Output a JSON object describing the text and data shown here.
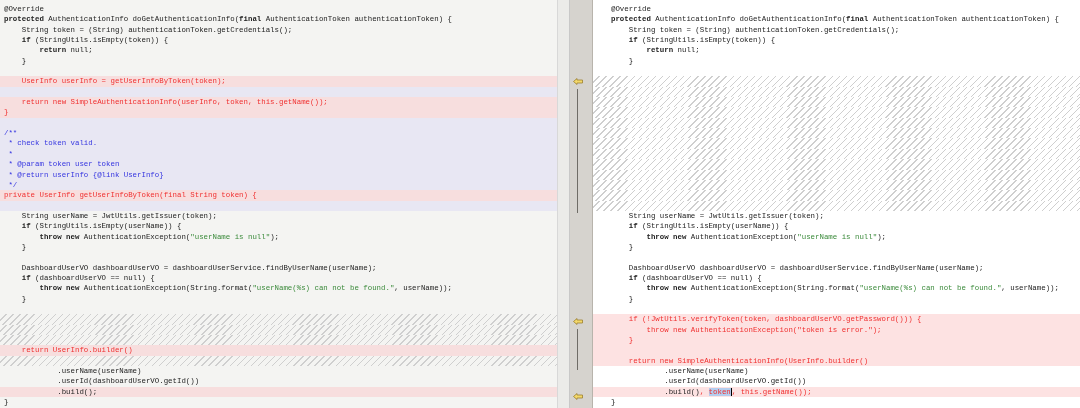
{
  "left_pane": {
    "lines": [
      {
        "kind": "plain",
        "text": "@Override"
      },
      {
        "kind": "plain",
        "parts": [
          {
            "text": "protected",
            "kind": "keyword"
          },
          {
            "text": " AuthenticationInfo doGetAuthenticationInfo("
          },
          {
            "text": "final",
            "kind": "keyword"
          },
          {
            "text": " AuthenticationToken authenticationToken) {"
          }
        ]
      },
      {
        "kind": "plain",
        "text": "    String token = (String) authenticationToken.getCredentials();"
      },
      {
        "kind": "plain",
        "parts": [
          {
            "text": "    if",
            "kind": "keyword"
          },
          {
            "text": " (StringUtils.isEmpty(token)) {"
          }
        ]
      },
      {
        "kind": "plain",
        "parts": [
          {
            "text": "        return",
            "kind": "keyword"
          },
          {
            "text": " null;"
          }
        ]
      },
      {
        "kind": "plain",
        "text": "    }"
      },
      {
        "kind": "plain"
      },
      {
        "kind": "changed",
        "text": "    UserInfo userInfo = getUserInfoByToken(token);"
      },
      {
        "kind": "unmatched"
      },
      {
        "kind": "changed",
        "text": "    return new SimpleAuthenticationInfo(userInfo, token, this.getName());"
      },
      {
        "kind": "changed",
        "text": "}"
      },
      {
        "kind": "unmatched"
      },
      {
        "kind": "unmatched",
        "text": "/**"
      },
      {
        "kind": "unmatched",
        "text": " * check token valid."
      },
      {
        "kind": "unmatched",
        "text": " *"
      },
      {
        "kind": "unmatched",
        "text": " * @param token user token"
      },
      {
        "kind": "unmatched",
        "text": " * @return userInfo {@link UserInfo}"
      },
      {
        "kind": "unmatched",
        "text": " */"
      },
      {
        "kind": "changed",
        "text": "private UserInfo getUserInfoByToken(final String token) {"
      },
      {
        "kind": "unmatched"
      },
      {
        "kind": "plain",
        "text": "    String userName = JwtUtils.getIssuer(token);"
      },
      {
        "kind": "plain",
        "parts": [
          {
            "text": "    if",
            "kind": "keyword"
          },
          {
            "text": " (StringUtils.isEmpty(userName)) {"
          }
        ]
      },
      {
        "kind": "plain",
        "parts": [
          {
            "text": "        throw new",
            "kind": "keyword"
          },
          {
            "text": " AuthenticationException("
          },
          {
            "text": "\"userName is null\"",
            "kind": "string"
          },
          {
            "text": ");"
          }
        ]
      },
      {
        "kind": "plain",
        "text": "    }"
      },
      {
        "kind": "plain"
      },
      {
        "kind": "plain",
        "text": "    DashboardUserVO dashboardUserVO = dashboardUserService.findByUserName(userName);"
      },
      {
        "kind": "plain",
        "parts": [
          {
            "text": "    if",
            "kind": "keyword"
          },
          {
            "text": " (dashboardUserVO == null) {"
          }
        ]
      },
      {
        "kind": "plain",
        "parts": [
          {
            "text": "        throw new",
            "kind": "keyword"
          },
          {
            "text": " AuthenticationException(String.format("
          },
          {
            "text": "\"userName(%s) can not be found.\"",
            "kind": "string"
          },
          {
            "text": ", userName));"
          }
        ]
      },
      {
        "kind": "plain",
        "text": "    }"
      },
      {
        "kind": "plain"
      },
      {
        "kind": "hatched"
      },
      {
        "kind": "hatched"
      },
      {
        "kind": "hatched"
      },
      {
        "kind": "changed",
        "text": "    return UserInfo.builder()"
      },
      {
        "kind": "hatched"
      },
      {
        "kind": "plain",
        "text": "            .userName(userName)"
      },
      {
        "kind": "plain",
        "text": "            .userId(dashboardUserVO.getId())"
      },
      {
        "kind": "changed",
        "parts": [
          {
            "text": "            .build();",
            "kind": "neutral"
          }
        ]
      },
      {
        "kind": "plain",
        "text": "}"
      }
    ]
  },
  "right_pane": {
    "lines": [
      {
        "kind": "plain",
        "text": "@Override"
      },
      {
        "kind": "plain",
        "parts": [
          {
            "text": "protected",
            "kind": "keyword"
          },
          {
            "text": " AuthenticationInfo doGetAuthenticationInfo("
          },
          {
            "text": "final",
            "kind": "keyword"
          },
          {
            "text": " AuthenticationToken authenticationToken) {"
          }
        ]
      },
      {
        "kind": "plain",
        "text": "    String token = (String) authenticationToken.getCredentials();"
      },
      {
        "kind": "plain",
        "parts": [
          {
            "text": "    if",
            "kind": "keyword"
          },
          {
            "text": " (StringUtils.isEmpty(token)) {"
          }
        ]
      },
      {
        "kind": "plain",
        "parts": [
          {
            "text": "        return",
            "kind": "keyword"
          },
          {
            "text": " null;"
          }
        ]
      },
      {
        "kind": "plain",
        "text": "    }"
      },
      {
        "kind": "plain"
      },
      {
        "kind": "hatched",
        "merge": true
      },
      {
        "kind": "hatched"
      },
      {
        "kind": "hatched"
      },
      {
        "kind": "hatched"
      },
      {
        "kind": "hatched"
      },
      {
        "kind": "hatched"
      },
      {
        "kind": "hatched"
      },
      {
        "kind": "hatched"
      },
      {
        "kind": "hatched"
      },
      {
        "kind": "hatched"
      },
      {
        "kind": "hatched"
      },
      {
        "kind": "hatched"
      },
      {
        "kind": "hatched"
      },
      {
        "kind": "plain",
        "text": "    String userName = JwtUtils.getIssuer(token);"
      },
      {
        "kind": "plain",
        "parts": [
          {
            "text": "    if",
            "kind": "keyword"
          },
          {
            "text": " (StringUtils.isEmpty(userName)) {"
          }
        ]
      },
      {
        "kind": "plain",
        "parts": [
          {
            "text": "        throw new",
            "kind": "keyword"
          },
          {
            "text": " AuthenticationException("
          },
          {
            "text": "\"userName is null\"",
            "kind": "string"
          },
          {
            "text": ");"
          }
        ]
      },
      {
        "kind": "plain",
        "text": "    }"
      },
      {
        "kind": "plain"
      },
      {
        "kind": "plain",
        "text": "    DashboardUserVO dashboardUserVO = dashboardUserService.findByUserName(userName);"
      },
      {
        "kind": "plain",
        "parts": [
          {
            "text": "    if",
            "kind": "keyword"
          },
          {
            "text": " (dashboardUserVO == null) {"
          }
        ]
      },
      {
        "kind": "plain",
        "parts": [
          {
            "text": "        throw new",
            "kind": "keyword"
          },
          {
            "text": " AuthenticationException(String.format("
          },
          {
            "text": "\"userName(%s) can not be found.\"",
            "kind": "string"
          },
          {
            "text": ", userName));"
          }
        ]
      },
      {
        "kind": "plain",
        "text": "    }"
      },
      {
        "kind": "plain"
      },
      {
        "kind": "changed",
        "merge": true,
        "text": "    if (!JwtUtils.verifyToken(token, dashboardUserVO.getPassword())) {"
      },
      {
        "kind": "changed",
        "text": "        throw new AuthenticationException(\"token is error.\");"
      },
      {
        "kind": "changed",
        "text": "    }"
      },
      {
        "kind": "changed"
      },
      {
        "kind": "changed",
        "text": "    return new SimpleAuthenticationInfo(UserInfo.builder()"
      },
      {
        "kind": "plain",
        "text": "            .userName(userName)"
      },
      {
        "kind": "plain",
        "text": "            .userId(dashboardUserVO.getId())"
      },
      {
        "kind": "changed",
        "merge": true,
        "parts": [
          {
            "text": "            .build()",
            "kind": "neutral"
          },
          {
            "text": ", "
          },
          {
            "text": "token",
            "kind": "selected"
          },
          {
            "text": ", this.getName());"
          }
        ]
      },
      {
        "kind": "plain",
        "text": "}"
      }
    ]
  }
}
